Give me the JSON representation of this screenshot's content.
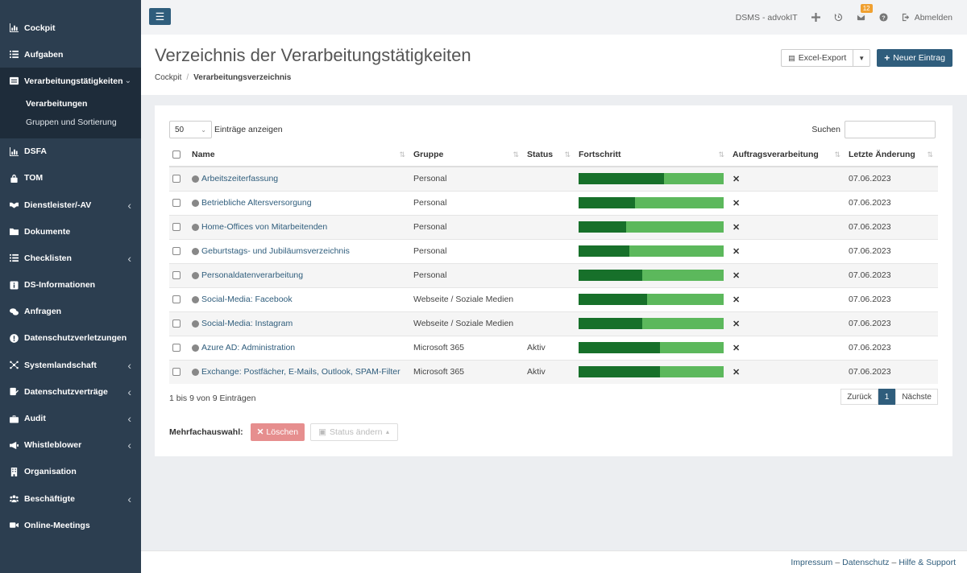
{
  "sidebar": {
    "items": [
      {
        "label": "Cockpit",
        "icon": "chart-icon"
      },
      {
        "label": "Aufgaben",
        "icon": "list-icon"
      },
      {
        "label": "Verarbeitungstätigkeiten",
        "icon": "table-icon",
        "expanded": true,
        "sub": [
          {
            "label": "Verarbeitungen"
          },
          {
            "label": "Gruppen und Sortierung"
          }
        ]
      },
      {
        "label": "DSFA",
        "icon": "chart-icon"
      },
      {
        "label": "TOM",
        "icon": "lock-icon"
      },
      {
        "label": "Dienstleister/-AV",
        "icon": "handshake-icon",
        "has_children": true
      },
      {
        "label": "Dokumente",
        "icon": "folder-icon"
      },
      {
        "label": "Checklisten",
        "icon": "list-icon",
        "has_children": true
      },
      {
        "label": "DS-Informationen",
        "icon": "info-icon"
      },
      {
        "label": "Anfragen",
        "icon": "comments-icon"
      },
      {
        "label": "Datenschutzverletzungen",
        "icon": "alert-icon"
      },
      {
        "label": "Systemlandschaft",
        "icon": "network-icon",
        "has_children": true
      },
      {
        "label": "Datenschutzverträge",
        "icon": "contract-icon",
        "has_children": true
      },
      {
        "label": "Audit",
        "icon": "briefcase-icon",
        "has_children": true
      },
      {
        "label": "Whistleblower",
        "icon": "megaphone-icon",
        "has_children": true
      },
      {
        "label": "Organisation",
        "icon": "building-icon"
      },
      {
        "label": "Beschäftigte",
        "icon": "users-icon",
        "has_children": true
      },
      {
        "label": "Online-Meetings",
        "icon": "video-icon"
      }
    ]
  },
  "topbar": {
    "org": "DSMS - advokIT",
    "notif_count": "12",
    "logout": "Abmelden"
  },
  "header": {
    "title": "Verzeichnis der Verarbeitungstätigkeiten",
    "breadcrumb_home": "Cockpit",
    "breadcrumb_sep": "/",
    "breadcrumb_current": "Verarbeitungsverzeichnis",
    "export_label": "Excel-Export",
    "new_label": "Neuer Eintrag"
  },
  "table": {
    "length_value": "50",
    "length_label": "Einträge anzeigen",
    "search_label": "Suchen",
    "columns": [
      "Name",
      "Gruppe",
      "Status",
      "Fortschritt",
      "Auftragsverarbeitung",
      "Letzte Änderung"
    ],
    "rows": [
      {
        "name": "Arbeitszeiterfassung",
        "group": "Personal",
        "status": "",
        "progress": 0.59,
        "av": "✕",
        "date": "07.06.2023"
      },
      {
        "name": "Betriebliche Altersversorgung",
        "group": "Personal",
        "status": "",
        "progress": 0.39,
        "av": "✕",
        "date": "07.06.2023"
      },
      {
        "name": "Home-Offices von Mitarbeitenden",
        "group": "Personal",
        "status": "",
        "progress": 0.33,
        "av": "✕",
        "date": "07.06.2023"
      },
      {
        "name": "Geburtstags- und Jubiläumsverzeichnis",
        "group": "Personal",
        "status": "",
        "progress": 0.35,
        "av": "✕",
        "date": "07.06.2023"
      },
      {
        "name": "Personaldatenverarbeitung",
        "group": "Personal",
        "status": "",
        "progress": 0.44,
        "av": "✕",
        "date": "07.06.2023"
      },
      {
        "name": "Social-Media: Facebook",
        "group": "Webseite / Soziale Medien",
        "status": "",
        "progress": 0.47,
        "av": "✕",
        "date": "07.06.2023"
      },
      {
        "name": "Social-Media: Instagram",
        "group": "Webseite / Soziale Medien",
        "status": "",
        "progress": 0.44,
        "av": "✕",
        "date": "07.06.2023"
      },
      {
        "name": "Azure AD: Administration",
        "group": "Microsoft 365",
        "status": "Aktiv",
        "progress": 0.56,
        "av": "✕",
        "date": "07.06.2023"
      },
      {
        "name": "Exchange: Postfächer, E-Mails, Outlook, SPAM-Filter",
        "group": "Microsoft 365",
        "status": "Aktiv",
        "progress": 0.56,
        "av": "✕",
        "date": "07.06.2023"
      }
    ],
    "info": "1 bis 9 von 9 Einträgen",
    "pager": {
      "prev": "Zurück",
      "current": "1",
      "next": "Nächste"
    }
  },
  "bulk": {
    "label": "Mehrfachauswahl:",
    "delete": "Löschen",
    "status": "Status ändern"
  },
  "footer": {
    "impressum": "Impressum",
    "datenschutz": "Datenschutz",
    "hilfe": "Hilfe & Support",
    "dash": "–"
  },
  "colors": {
    "sidebar": "#2c3e50",
    "primary": "#2f5d7c",
    "progress_dark": "#17702a",
    "progress_light": "#5cb85c",
    "danger": "#e68e8e"
  }
}
